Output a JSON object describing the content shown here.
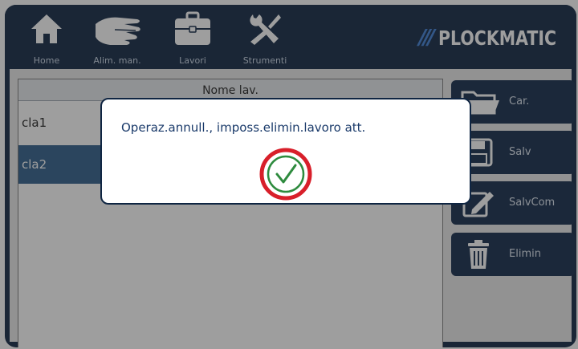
{
  "topbar": {
    "nav": [
      {
        "label": "Home",
        "icon": "home-icon"
      },
      {
        "label": "Alim. man.",
        "icon": "hand-icon"
      },
      {
        "label": "Lavori",
        "icon": "briefcase-icon"
      },
      {
        "label": "Strumenti",
        "icon": "tools-icon"
      }
    ],
    "brand": {
      "slashes": "///",
      "name": "PLOCKMATIC"
    }
  },
  "list": {
    "header": "Nome lav.",
    "rows": [
      {
        "name": "cla1",
        "selected": false
      },
      {
        "name": "cla2",
        "selected": true
      }
    ]
  },
  "side_buttons": [
    {
      "label": "Car.",
      "icon": "folder-icon"
    },
    {
      "label": "Salv",
      "icon": "save-icon"
    },
    {
      "label": "SalvCom",
      "icon": "edit-icon"
    },
    {
      "label": "Elimin",
      "icon": "trash-icon"
    }
  ],
  "dialog": {
    "message": "Operaz.annull., imposs.elimin.lavoro att.",
    "ok_icon": "checkmark-icon"
  },
  "colors": {
    "navy": "#0f2542",
    "brand_blue": "#3d7fd6",
    "selected_row": "#2f5e8a",
    "ok_ring_outer": "#d81f2a",
    "ok_ring_inner": "#2e8b3e"
  }
}
